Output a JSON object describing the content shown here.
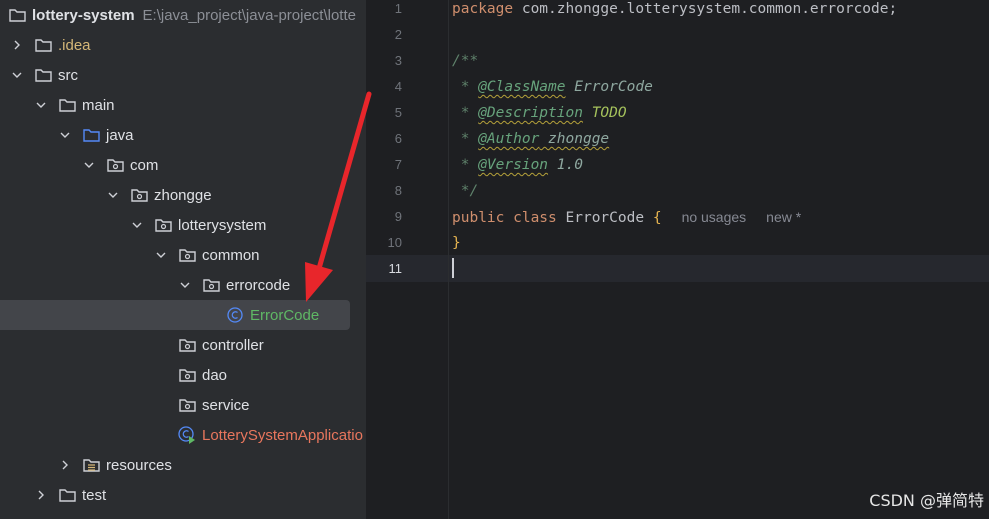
{
  "project": {
    "root_name": "lottery-system",
    "root_path": "E:\\java_project\\java-project\\lotte",
    "items": [
      {
        "label": "lottery-system",
        "icon": "folder-icon"
      },
      {
        "label": ".idea",
        "icon": "folder-icon"
      },
      {
        "label": "src",
        "icon": "folder-icon"
      },
      {
        "label": "main",
        "icon": "folder-icon"
      },
      {
        "label": "java",
        "icon": "source-folder-icon"
      },
      {
        "label": "com",
        "icon": "package-icon"
      },
      {
        "label": "zhongge",
        "icon": "package-icon"
      },
      {
        "label": "lotterysystem",
        "icon": "package-icon"
      },
      {
        "label": "common",
        "icon": "package-icon"
      },
      {
        "label": "errorcode",
        "icon": "package-icon"
      },
      {
        "label": "ErrorCode",
        "icon": "class-icon"
      },
      {
        "label": "controller",
        "icon": "package-icon"
      },
      {
        "label": "dao",
        "icon": "package-icon"
      },
      {
        "label": "service",
        "icon": "package-icon"
      },
      {
        "label": "LotterySystemApplicatio",
        "icon": "spring-boot-class-icon"
      },
      {
        "label": "resources",
        "icon": "resources-folder-icon"
      },
      {
        "label": "test",
        "icon": "folder-icon"
      }
    ]
  },
  "editor": {
    "line_numbers": [
      "1",
      "2",
      "3",
      "4",
      "5",
      "6",
      "7",
      "8",
      "9",
      "10",
      "11"
    ],
    "current_line": "11",
    "code": {
      "l1_kw": "package",
      "l1_rest": " com.zhongge.lotterysystem.common.errorcode;",
      "l3": "/**",
      "l4_star": " * ",
      "l4_tag": "@ClassName",
      "l4_val": " ErrorCode",
      "l5_star": " * ",
      "l5_tag": "@Description",
      "l5_val": " TODO",
      "l6_star": " * ",
      "l6_tag": "@Author",
      "l6_val": " zhongge",
      "l7_star": " * ",
      "l7_tag": "@Version",
      "l7_val": " 1.0",
      "l8": " */",
      "l9_kw1": "public",
      "l9_kw2": " class",
      "l9_name": " ErrorCode",
      "l9_brace": " {",
      "l9_hint1": "no usages",
      "l9_hint2": "new *",
      "l10": "}"
    }
  },
  "watermark": "CSDN @弹简特",
  "colors": {
    "arrow": "#e8262b",
    "selected_row": "#43454a"
  }
}
